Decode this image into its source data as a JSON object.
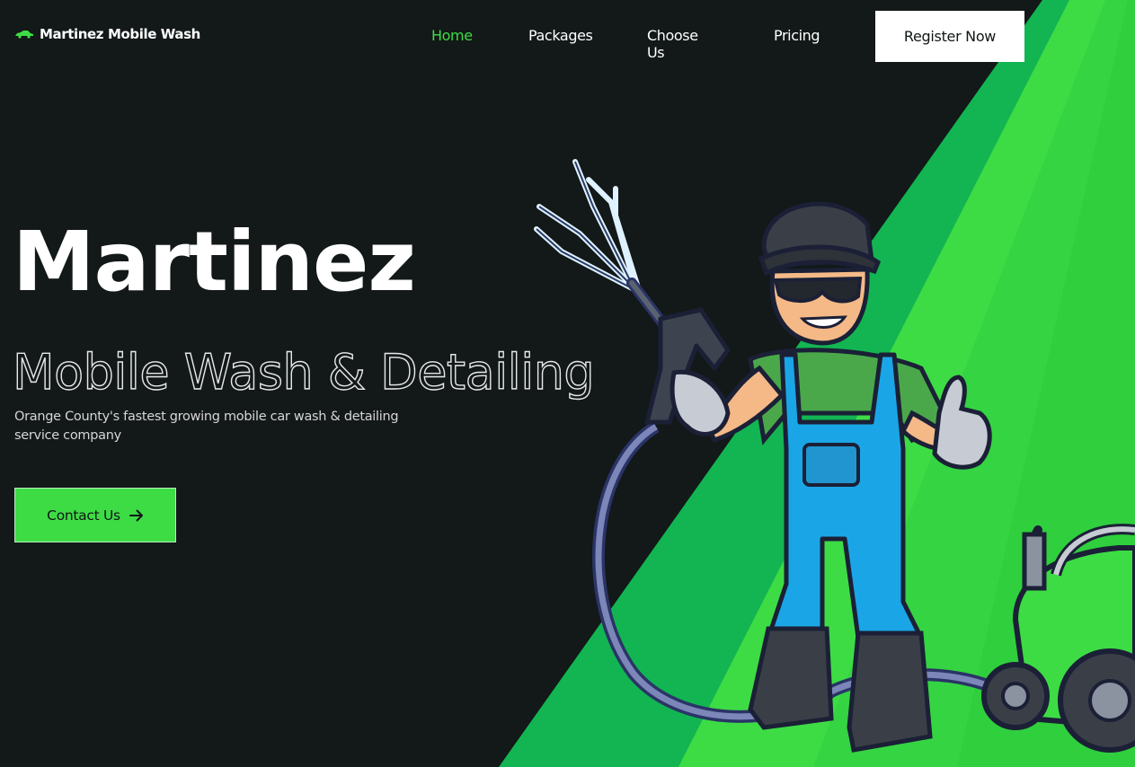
{
  "header": {
    "brand_logo_icon": "car-icon",
    "brand_name": "Martinez Mobile Wash",
    "nav": [
      {
        "label": "Home",
        "active": true
      },
      {
        "label": "Packages",
        "active": false
      },
      {
        "label": "Choose Us",
        "active": false
      },
      {
        "label": "Pricing",
        "active": false
      }
    ],
    "register_label": "Register Now"
  },
  "hero": {
    "title": "Martinez",
    "subtitle": "Mobile Wash & Detailing",
    "description": "Orange County's fastest growing mobile car wash & detailing service company",
    "contact_label": "Contact Us",
    "contact_icon": "arrow-right-icon",
    "illustration": "car-wash-worker-mascot"
  },
  "colors": {
    "background": "#131818",
    "accent_green": "#3ddc45",
    "dark_green": "#12b552",
    "text_white": "#ffffff"
  }
}
